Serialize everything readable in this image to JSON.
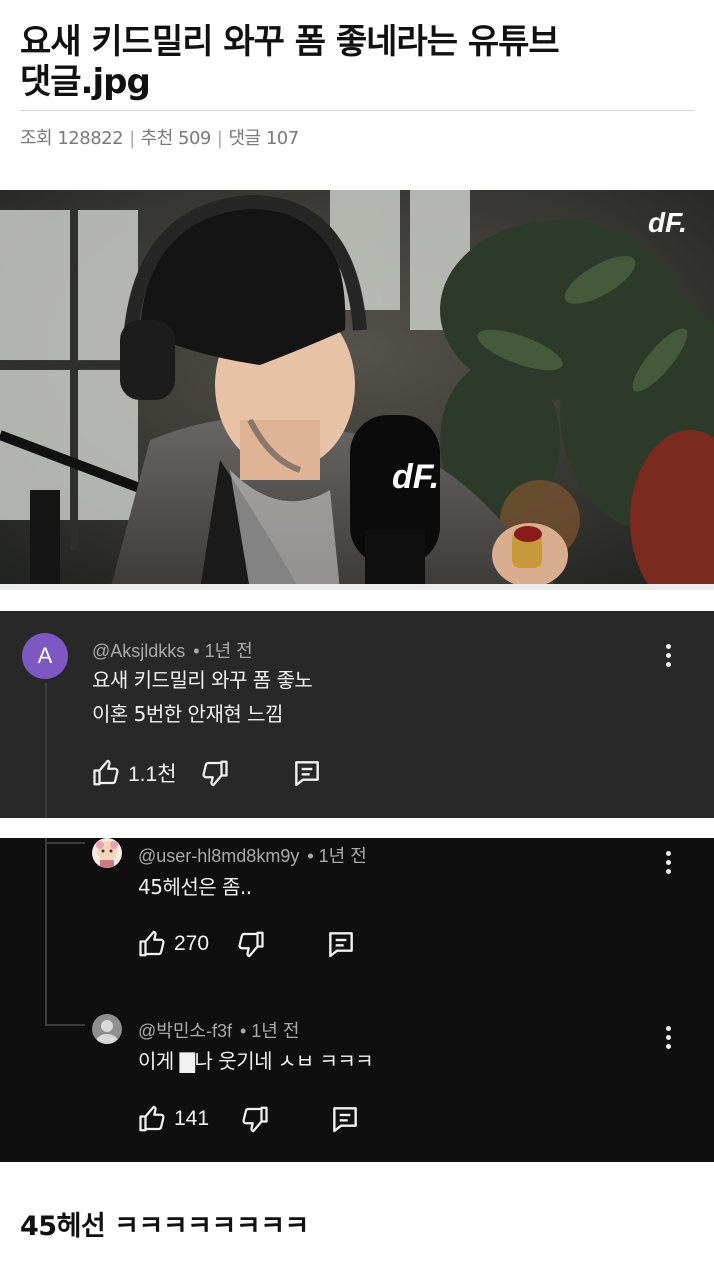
{
  "post": {
    "title_line1": "요새 키드밀리 와꾸 폼 좋네라는 유튜브",
    "title_line2": "댓글.jpg",
    "views_label": "조회",
    "views": "128822",
    "recommend_label": "추천",
    "recommend": "509",
    "comments_label": "댓글",
    "comments": "107"
  },
  "video": {
    "watermark": "dF.",
    "mic_logo": "dF."
  },
  "comment_main": {
    "avatar_letter": "A",
    "avatar_color": "#7e57c2",
    "handle": "@Aksjldkks",
    "time": "• 1년 전",
    "line1": "요새 키드밀리 와꾸 폼 좋노",
    "line2": "이혼 5번한 안재현 느낌",
    "likes": "1.1천"
  },
  "reply_1": {
    "handle": "@user-hl8md8km9y",
    "time": "• 1년 전",
    "text": "45헤선은 좀..",
    "likes": "270"
  },
  "reply_2": {
    "handle": "@박민소-f3f",
    "time": "• 1년 전",
    "text": "이게 ▇나 웃기네 ㅅㅂ ㅋㅋㅋ",
    "likes": "141"
  },
  "footer": {
    "text": "45헤선 ㅋㅋㅋㅋㅋㅋㅋㅋ"
  },
  "icons": [
    "like-icon",
    "dislike-icon",
    "reply-icon",
    "more-icon"
  ]
}
